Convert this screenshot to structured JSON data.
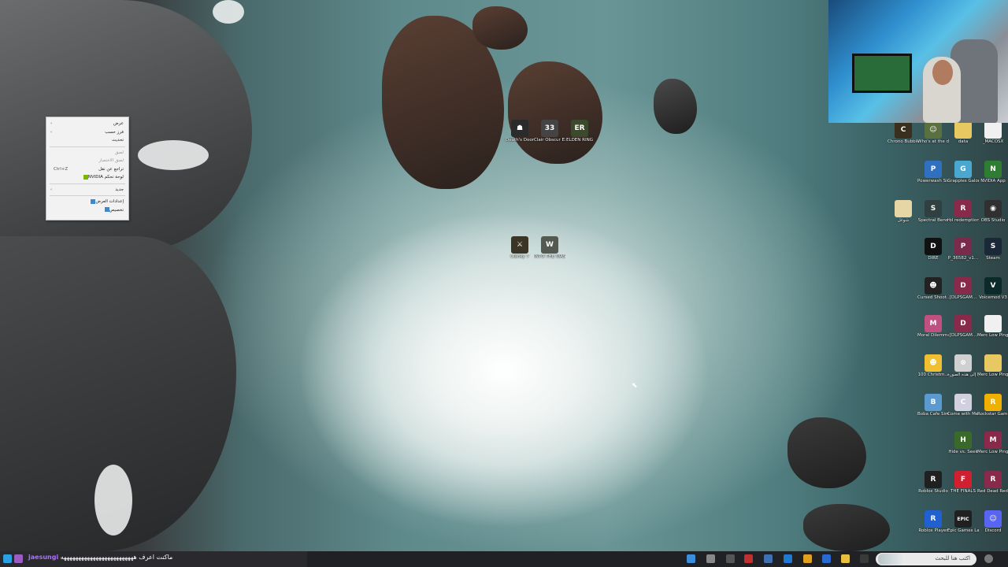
{
  "context_menu": {
    "items": [
      {
        "label": "عرض",
        "arrow": "‹",
        "disabled": false
      },
      {
        "label": "فرز حسب",
        "arrow": "‹",
        "disabled": false
      },
      {
        "label": "تحديث",
        "disabled": false
      },
      {
        "sep": true
      },
      {
        "label": "لصق",
        "disabled": true
      },
      {
        "label": "لصق الاختصار",
        "disabled": true
      },
      {
        "label": "تراجع عن نقل",
        "shortcut": "Ctrl+Z",
        "disabled": false
      },
      {
        "label": "لوحة تحكم NVIDIA",
        "icon": "nvidia",
        "disabled": false
      },
      {
        "sep": true
      },
      {
        "label": "جديد",
        "arrow": "‹",
        "disabled": false
      },
      {
        "sep": true
      },
      {
        "label": "إعدادات العرض",
        "icon": "display",
        "disabled": false
      },
      {
        "label": "تخصيص",
        "icon": "personalize",
        "disabled": false
      }
    ]
  },
  "desktop_center_icons": [
    {
      "label": "Death's Door",
      "color": "#2b2b2b",
      "glyph": "☗"
    },
    {
      "label": "Clair Obscur Expedition 33",
      "color": "#444",
      "glyph": "33"
    },
    {
      "label": "ELDEN RING",
      "color": "#3b4a2a",
      "glyph": "ER"
    },
    {
      "label": "Clanky 7",
      "color": "#3a3526",
      "glyph": "⚔"
    },
    {
      "label": "INTO THE WASTEL...",
      "color": "#555a50",
      "glyph": "W"
    }
  ],
  "desktop_right_icons": [
    {
      "label": "Chrono Bubble T",
      "color": "#3a2e1e",
      "glyph": "C"
    },
    {
      "label": "Who's at the door Demo",
      "color": "#5a7040",
      "glyph": "☺"
    },
    {
      "label": "data",
      "color": "#e8c860",
      "glyph": ""
    },
    {
      "label": "_MACOSX",
      "color": "#f0f0f0",
      "glyph": ""
    },
    {
      "label": "Powerwash Simulator",
      "color": "#3070c0",
      "glyph": "P"
    },
    {
      "label": "Grapples Galore",
      "color": "#4aa8d0",
      "glyph": "G"
    },
    {
      "label": "NVIDIA App",
      "color": "#2e7d32",
      "glyph": "N"
    },
    {
      "label": "شوغل",
      "color": "#e6d6a6",
      "glyph": ""
    },
    {
      "label": "Spectral Bend",
      "color": "#304040",
      "glyph": "S"
    },
    {
      "label": "rbl redemption",
      "color": "#8a2a4a",
      "glyph": "R"
    },
    {
      "label": "OBS Studio",
      "color": "#303030",
      "glyph": "◉"
    },
    {
      "label": "DIRE",
      "color": "#111",
      "glyph": "D"
    },
    {
      "label": "P_36582_v1...",
      "color": "#7a2a4a",
      "glyph": "P"
    },
    {
      "label": "Steam",
      "color": "#1b2838",
      "glyph": "S"
    },
    {
      "label": "Cursed Shoot...",
      "color": "#222",
      "glyph": "☻"
    },
    {
      "label": "[DLPSGAM...",
      "color": "#8a2a4a",
      "glyph": "D"
    },
    {
      "label": "Voicemod V3",
      "color": "#0d2a2a",
      "glyph": "V"
    },
    {
      "label": "Moral Dilemma T...",
      "color": "#c05080",
      "glyph": "M"
    },
    {
      "label": "[DLPSGAM...",
      "color": "#8a2a4a",
      "glyph": "D"
    },
    {
      "label": "Merc Low Ping...",
      "color": "#f0f0f0",
      "glyph": ""
    },
    {
      "label": "100 Christm...",
      "color": "#f0c030",
      "glyph": "☻"
    },
    {
      "label": "عرف إلى هذه الصورة",
      "color": "#d0d0d0",
      "glyph": "⊗"
    },
    {
      "label": "Merc Low Ping-2025...",
      "color": "#e8c860",
      "glyph": ""
    },
    {
      "label": "Boba Cafe Simulat...",
      "color": "#5a9ad0",
      "glyph": "B"
    },
    {
      "label": "Come with Me...",
      "color": "#d0d0e0",
      "glyph": "C"
    },
    {
      "label": "Rockstar Games",
      "color": "#f0b000",
      "glyph": "R"
    },
    {
      "label": "Hide vs. Seek",
      "color": "#3a6a2a",
      "glyph": "H"
    },
    {
      "label": "Merc Low Ping-2025...",
      "color": "#8a2a4a",
      "glyph": "M"
    },
    {
      "label": "Roblox Studio",
      "color": "#202020",
      "glyph": "R"
    },
    {
      "label": "THE FINALS",
      "color": "#d02030",
      "glyph": "F"
    },
    {
      "label": "Red Dead Redempti...",
      "color": "#8a2a4a",
      "glyph": "R"
    },
    {
      "label": "Roblox Player",
      "color": "#2060d0",
      "glyph": "R"
    },
    {
      "label": "Epic Games Launcher",
      "color": "#202020",
      "glyph": "EPIC"
    },
    {
      "label": "Discord",
      "color": "#5865f2",
      "glyph": "☺"
    }
  ],
  "taskbar": {
    "chat_user": "jaesungi",
    "chat_message": "ماكنت اعرف هههههههههههههههههههههههههه",
    "search_placeholder": "اكتب هنا للبحث"
  }
}
